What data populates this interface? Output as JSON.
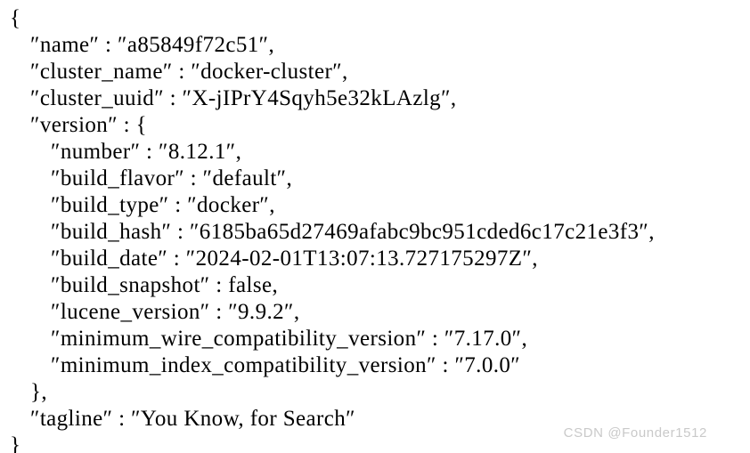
{
  "document": {
    "type": "json-response",
    "background_color": "#ffffff",
    "text_color": "#000000",
    "lines": [
      {
        "indent": 0,
        "text": "{"
      },
      {
        "indent": 1,
        "text": "″name″ : ″a85849f72c51″,"
      },
      {
        "indent": 1,
        "text": "″cluster_name″ : ″docker-cluster″,"
      },
      {
        "indent": 1,
        "text": "″cluster_uuid″ : ″X-jIPrY4Sqyh5e32kLAzlg″,"
      },
      {
        "indent": 1,
        "text": "″version″ : {"
      },
      {
        "indent": 2,
        "text": "″number″ : ″8.12.1″,"
      },
      {
        "indent": 2,
        "text": "″build_flavor″ : ″default″,"
      },
      {
        "indent": 2,
        "text": "″build_type″ : ″docker″,"
      },
      {
        "indent": 2,
        "text": "″build_hash″ : ″6185ba65d27469afabc9bc951cded6c17c21e3f3″,"
      },
      {
        "indent": 2,
        "text": "″build_date″ : ″2024-02-01T13:07:13.727175297Z″,"
      },
      {
        "indent": 2,
        "text": "″build_snapshot″ : false,"
      },
      {
        "indent": 2,
        "text": "″lucene_version″ : ″9.9.2″,"
      },
      {
        "indent": 2,
        "text": "″minimum_wire_compatibility_version″ : ″7.17.0″,"
      },
      {
        "indent": 2,
        "text": "″minimum_index_compatibility_version″ : ″7.0.0″"
      },
      {
        "indent": 1,
        "text": "},"
      },
      {
        "indent": 1,
        "text": "″tagline″ : ″You Know, for Search″"
      },
      {
        "indent": 0,
        "text": "}"
      }
    ],
    "values": {
      "name": "a85849f72c51",
      "cluster_name": "docker-cluster",
      "cluster_uuid": "X-jIPrY4Sqyh5e32kLAzlg",
      "version": {
        "number": "8.12.1",
        "build_flavor": "default",
        "build_type": "docker",
        "build_hash": "6185ba65d27469afabc9bc951cded6c17c21e3f3",
        "build_date": "2024-02-01T13:07:13.727175297Z",
        "build_snapshot": "false",
        "lucene_version": "9.9.2",
        "minimum_wire_compatibility_version": "7.17.0",
        "minimum_index_compatibility_version": "7.0.0"
      },
      "tagline": "You Know, for Search"
    }
  },
  "watermark": {
    "text": "CSDN @Founder1512",
    "color": "#c9c9c9"
  }
}
